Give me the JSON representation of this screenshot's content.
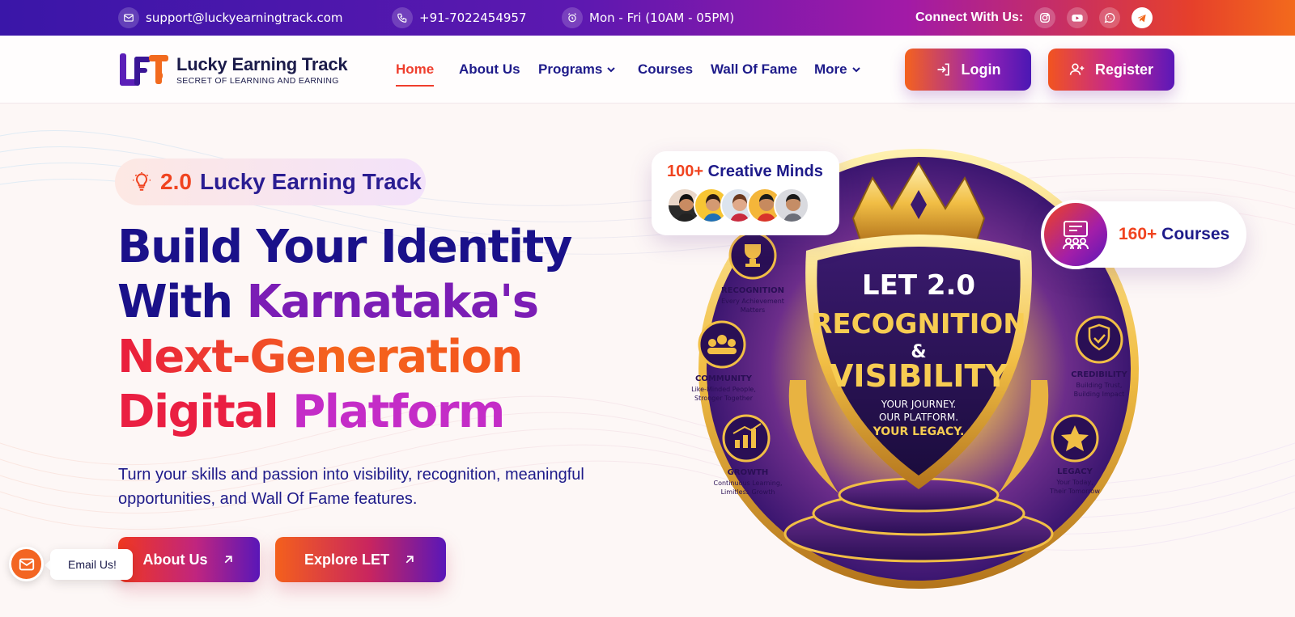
{
  "topbar": {
    "email": "support@luckyearningtrack.com",
    "phone": "+91-7022454957",
    "hours": "Mon - Fri (10AM - 05PM)",
    "connect_label": "Connect With Us:",
    "socials": [
      "instagram-icon",
      "youtube-icon",
      "whatsapp-icon",
      "telegram-icon"
    ]
  },
  "brand": {
    "name": "Lucky Earning Track",
    "tagline": "SECRET OF LEARNING AND EARNING"
  },
  "nav": {
    "items": [
      {
        "label": "Home",
        "active": true
      },
      {
        "label": "About Us"
      },
      {
        "label": "Programs",
        "dropdown": true
      },
      {
        "label": "Courses"
      },
      {
        "label": "Wall Of Fame"
      },
      {
        "label": "More",
        "dropdown": true
      }
    ],
    "login": "Login",
    "register": "Register"
  },
  "hero": {
    "pill_version": "2.0",
    "pill_text": "Lucky Earning Track",
    "headline_line1": "Build Your Identity",
    "headline_line2a": "With",
    "headline_line2b": "Karnataka's",
    "headline_line3": "Next-Generation",
    "headline_line4a": "Digital",
    "headline_line4b": "Platform",
    "subtitle": "Turn your skills and passion into visibility, recognition, meaningful opportunities, and Wall Of Fame features.",
    "cta_primary": "About Us",
    "cta_secondary": "Explore LET"
  },
  "stats": {
    "minds_count": "100+",
    "minds_label": "Creative Minds",
    "courses_count": "160+",
    "courses_label": "Courses"
  },
  "badge": {
    "title_top": "LET 2.0",
    "title_main": "RECOGNITION",
    "amp": "&",
    "title_sub": "VISIBILITY",
    "line1": "YOUR JOURNEY.",
    "line2": "OUR PLATFORM.",
    "line3": "YOUR LEGACY.",
    "pillars": [
      {
        "name": "RECOGNITION",
        "desc1": "Every Achievement",
        "desc2": "Matters"
      },
      {
        "name": "COMMUNITY",
        "desc1": "Like-Minded People,",
        "desc2": "Stronger Together"
      },
      {
        "name": "GROWTH",
        "desc1": "Continuous Learning,",
        "desc2": "Limitless Growth"
      },
      {
        "name": "CREDIBILITY",
        "desc1": "Building Trust,",
        "desc2": "Building Impact"
      },
      {
        "name": "LEGACY",
        "desc1": "Your Today,",
        "desc2": "Their Tomorrow"
      }
    ]
  },
  "floating": {
    "email_label": "Email Us!"
  },
  "colors": {
    "primary": "#1e1b8a",
    "accent_orange": "#f0431f",
    "accent_purple": "#7b1db5",
    "gold": "#f5c542"
  }
}
